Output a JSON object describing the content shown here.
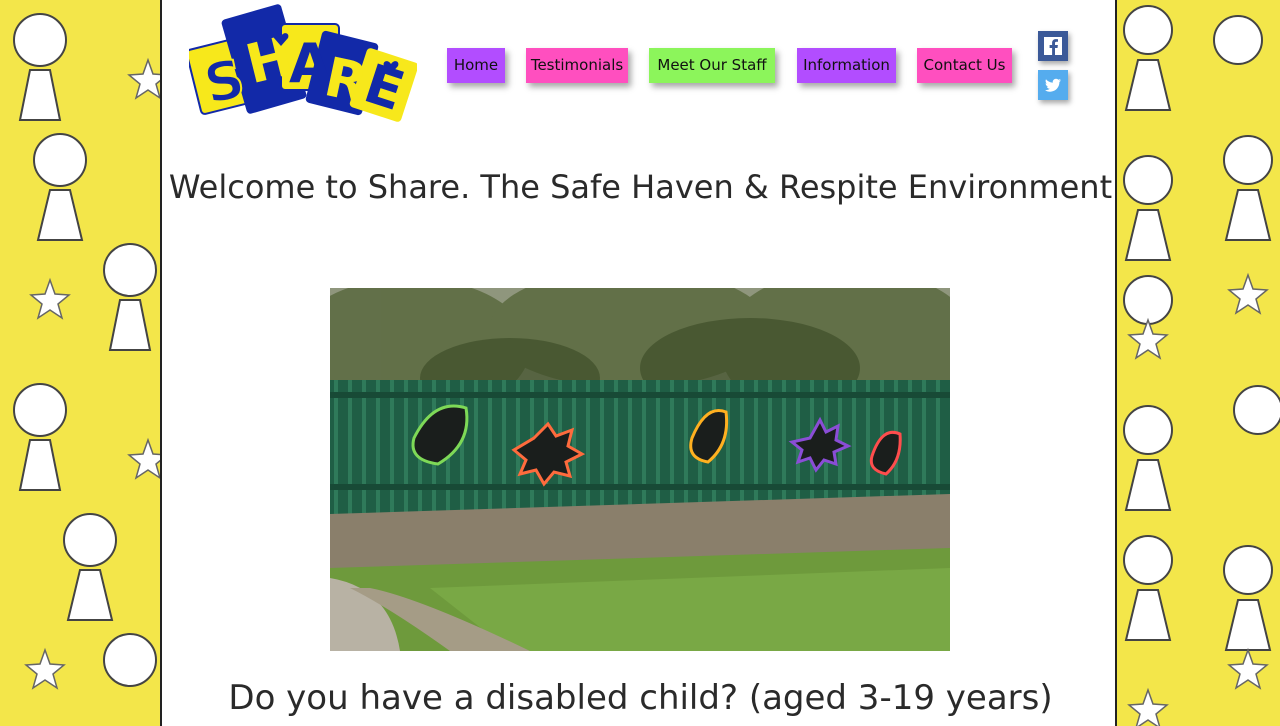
{
  "logo": {
    "text": "SHARE",
    "colors": {
      "card_yellow": "#f7e81b",
      "card_blue": "#1229a8",
      "letter_blue": "#1229a8",
      "letter_yellow": "#f7e81b"
    }
  },
  "nav": {
    "items": [
      {
        "label": "Home",
        "color": "#b24dff"
      },
      {
        "label": "Testimonials",
        "color": "#ff4fbf"
      },
      {
        "label": "Meet Our Staff",
        "color": "#8cf55b"
      },
      {
        "label": "Information",
        "color": "#b24dff"
      },
      {
        "label": "Contact Us",
        "color": "#ff4fbf"
      }
    ]
  },
  "social": [
    {
      "icon": "facebook-icon",
      "color": "#3b5998"
    },
    {
      "icon": "twitter-icon",
      "color": "#55acee"
    }
  ],
  "main": {
    "title": "Welcome to Share. The Safe Haven & Respite Environment",
    "subtitle": "Do you have a disabled child? (aged 3-19 years)"
  },
  "theme": {
    "side_background": "#f3e64a",
    "page_background": "#ffffff",
    "text": "#2a2a2a"
  }
}
